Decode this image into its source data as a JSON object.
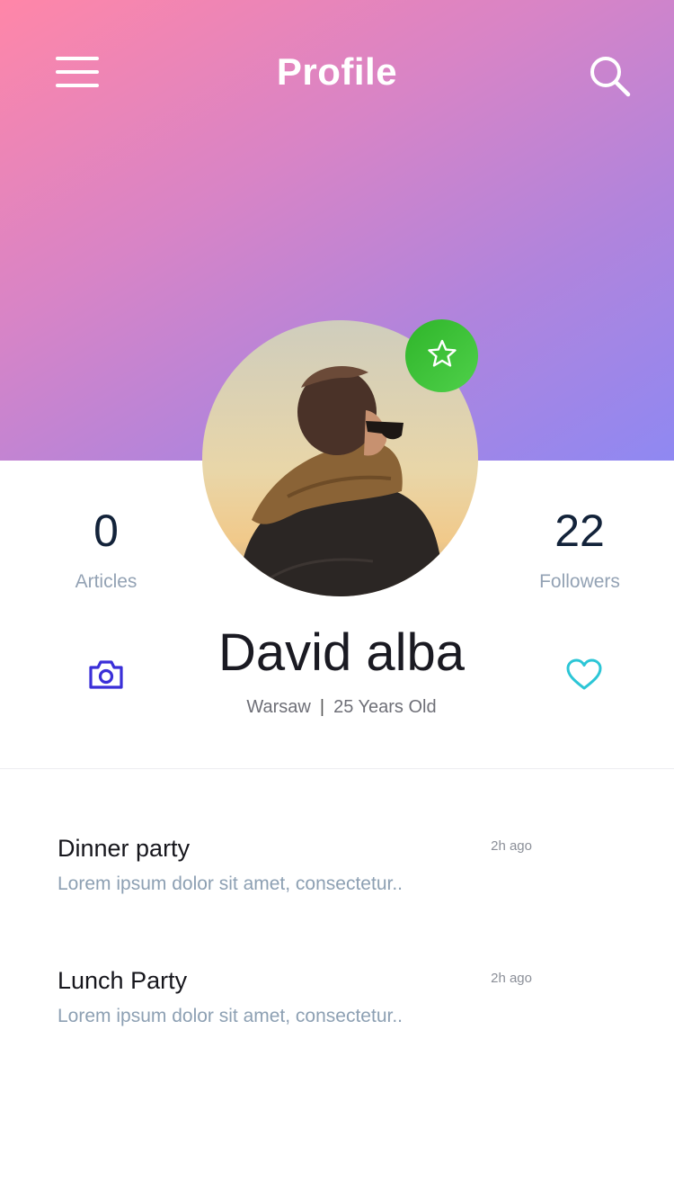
{
  "header": {
    "title": "Profile",
    "menu_icon": "hamburger-menu-icon",
    "search_icon": "search-icon"
  },
  "profile": {
    "name": "David alba",
    "city": "Warsaw",
    "separator": "|",
    "age": "25 Years Old",
    "badge_icon": "star-icon",
    "avatar": "person-with-scarf-photo"
  },
  "stats": {
    "articles": {
      "value": "0",
      "label": "Articles"
    },
    "followers": {
      "value": "22",
      "label": "Followers"
    }
  },
  "actions": {
    "camera_icon": "camera-icon",
    "heart_icon": "heart-icon"
  },
  "posts": [
    {
      "title": "Dinner party",
      "time": "2h ago",
      "body": "Lorem ipsum dolor sit amet, consectetur.."
    },
    {
      "title": "Lunch Party",
      "time": "2h ago",
      "body": "Lorem ipsum dolor sit amet, consectetur.."
    }
  ],
  "colors": {
    "gradient_start": "#ff86a8",
    "gradient_end": "#8f88f2",
    "badge": "#3ac136",
    "camera": "#3a2fd8",
    "heart": "#2cc6d6"
  }
}
